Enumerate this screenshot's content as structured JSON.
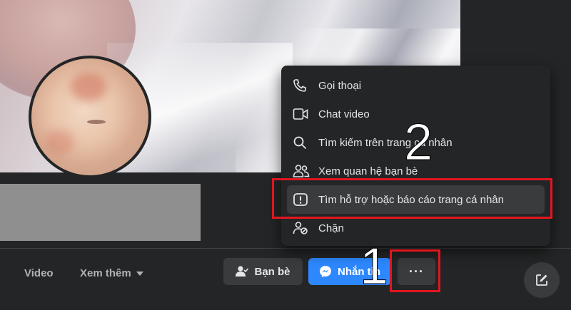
{
  "nav": {
    "video_label": "Video",
    "more_label": "Xem thêm"
  },
  "actions": {
    "friends_label": "Bạn bè",
    "message_label": "Nhắn tin",
    "more_dots": "···"
  },
  "menu": {
    "items": [
      {
        "label": "Gọi thoại",
        "icon": "phone-icon"
      },
      {
        "label": "Chat video",
        "icon": "video-camera-icon"
      },
      {
        "label": "Tìm kiếm trên trang cá nhân",
        "icon": "search-icon"
      },
      {
        "label": "Xem quan hệ bạn bè",
        "icon": "friends-icon"
      },
      {
        "label": "Tìm hỗ trợ hoặc báo cáo trang cá nhân",
        "icon": "report-icon"
      },
      {
        "label": "Chặn",
        "icon": "block-user-icon"
      }
    ]
  },
  "annotations": {
    "step1": "1",
    "step2": "2",
    "highlight_color": "#e1161f"
  },
  "colors": {
    "accent": "#2d88ff",
    "background": "#18191a",
    "surface": "#242526"
  }
}
